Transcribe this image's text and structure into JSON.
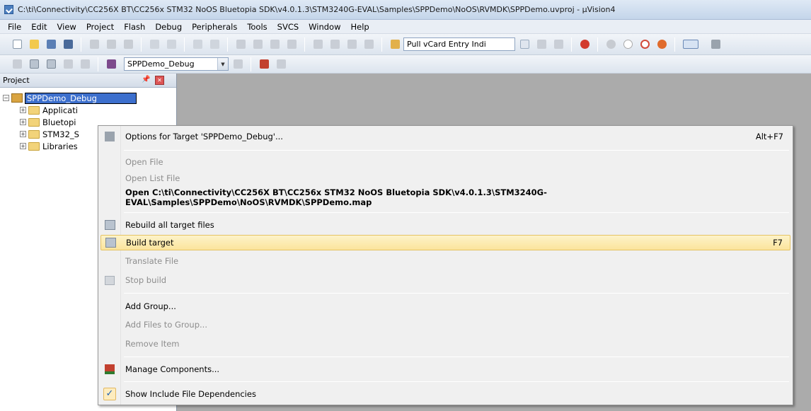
{
  "window": {
    "title": "C:\\ti\\Connectivity\\CC256X BT\\CC256x STM32 NoOS Bluetopia SDK\\v4.0.1.3\\STM3240G-EVAL\\Samples\\SPPDemo\\NoOS\\RVMDK\\SPPDemo.uvproj - µVision4"
  },
  "menubar": {
    "items": [
      "File",
      "Edit",
      "View",
      "Project",
      "Flash",
      "Debug",
      "Peripherals",
      "Tools",
      "SVCS",
      "Window",
      "Help"
    ]
  },
  "toolbar1": {
    "find_combo_value": "Pull vCard Entry Indi"
  },
  "toolbar2": {
    "target_combo_value": "SPPDemo_Debug"
  },
  "project_panel": {
    "title": "Project",
    "root_label": "SPPDemo_Debug",
    "groups": [
      "Applicati",
      "Bluetopi",
      "STM32_S",
      "Libraries"
    ]
  },
  "context_menu": {
    "options_target": "Options for Target 'SPPDemo_Debug'...",
    "options_target_shortcut": "Alt+F7",
    "open_file": "Open File",
    "open_list_file": "Open List File",
    "open_map": "Open C:\\ti\\Connectivity\\CC256X BT\\CC256x STM32 NoOS Bluetopia SDK\\v4.0.1.3\\STM3240G-EVAL\\Samples\\SPPDemo\\NoOS\\RVMDK\\SPPDemo.map",
    "rebuild_all": "Rebuild all target files",
    "build_target": "Build target",
    "build_target_shortcut": "F7",
    "translate_file": "Translate File",
    "stop_build": "Stop build",
    "add_group": "Add Group...",
    "add_files": "Add Files to Group...",
    "remove_item": "Remove Item",
    "manage_components": "Manage Components...",
    "show_include_deps": "Show Include File Dependencies"
  },
  "colors": {
    "highlight": "#fbe49c",
    "selection": "#3c6fcd"
  }
}
